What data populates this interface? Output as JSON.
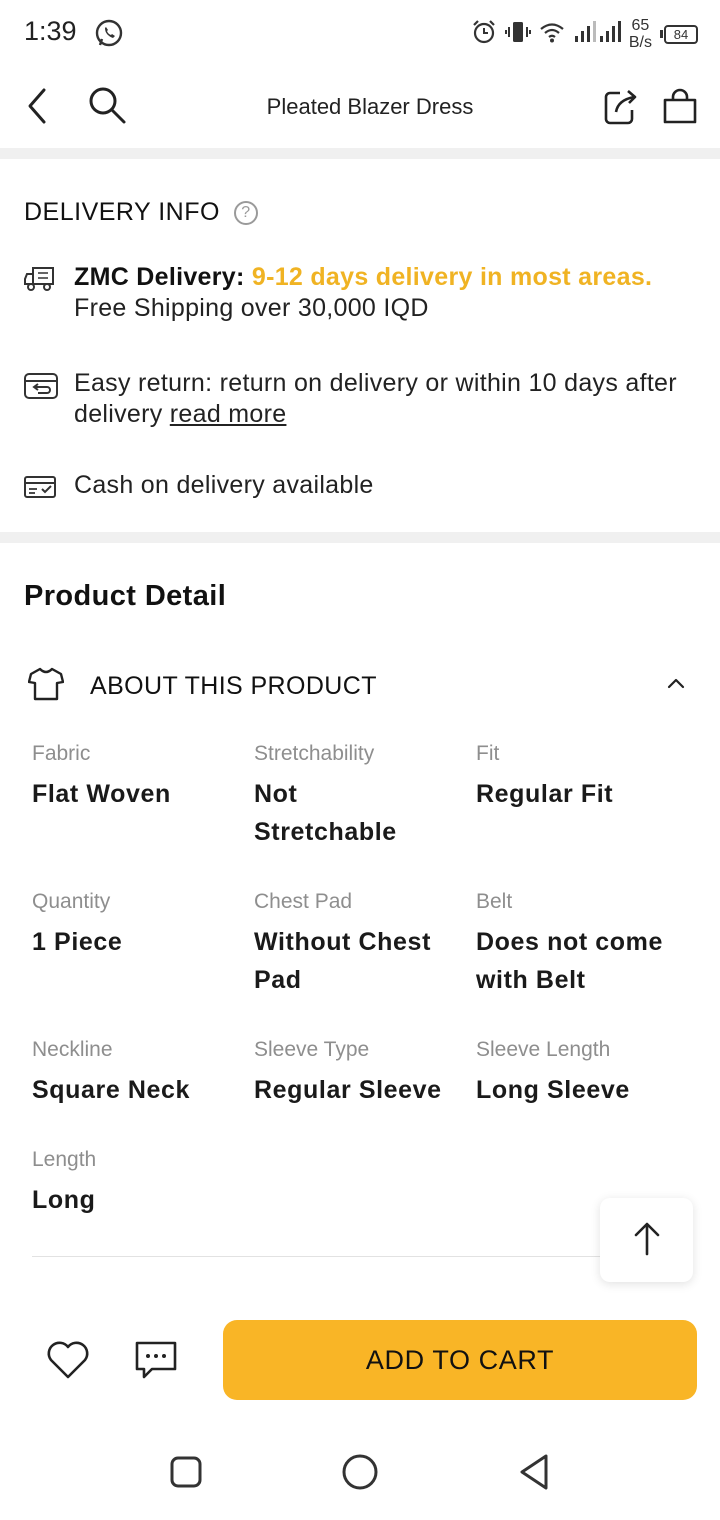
{
  "status_bar": {
    "time": "1:39",
    "net_speed_value": "65",
    "net_speed_unit": "B/s",
    "battery": "84"
  },
  "header": {
    "title": "Pleated Blazer Dress"
  },
  "delivery": {
    "title": "DELIVERY INFO",
    "help_glyph": "?",
    "zmc_label": "ZMC Delivery:",
    "zmc_highlight": "9-12 days delivery in most areas.",
    "zmc_rest": "Free Shipping over 30,000 IQD",
    "return_text": "Easy return: return on delivery or within 10 days after delivery",
    "return_link": "read more",
    "cod_text": "Cash on delivery available"
  },
  "product_detail": {
    "title": "Product Detail",
    "about_label": "ABOUT THIS PRODUCT",
    "attributes": [
      {
        "label": "Fabric",
        "value": "Flat Woven"
      },
      {
        "label": "Stretchability",
        "value": "Not Stretchable"
      },
      {
        "label": "Fit",
        "value": "Regular Fit"
      },
      {
        "label": "Quantity",
        "value": "1 Piece"
      },
      {
        "label": "Chest Pad",
        "value": "Without Chest Pad"
      },
      {
        "label": "Belt",
        "value": "Does not come with Belt"
      },
      {
        "label": "Neckline",
        "value": "Square Neck"
      },
      {
        "label": "Sleeve Type",
        "value": "Regular Sleeve"
      },
      {
        "label": "Sleeve Length",
        "value": "Long Sleeve"
      },
      {
        "label": "Length",
        "value": "Long"
      }
    ]
  },
  "actions": {
    "add_to_cart": "ADD TO CART"
  },
  "colors": {
    "accent": "#f0b323",
    "cart_button": "#f9b526"
  },
  "icons": [
    "whatsapp-icon",
    "alarm-icon",
    "vibrate-icon",
    "wifi-icon",
    "signal-icon",
    "battery-icon",
    "back-icon",
    "search-icon",
    "share-icon",
    "bag-icon",
    "help-icon",
    "truck-icon",
    "return-icon",
    "cash-icon",
    "shirt-icon",
    "chevron-up-icon",
    "arrow-up-icon",
    "heart-icon",
    "chat-icon",
    "nav-recents-icon",
    "nav-home-icon",
    "nav-back-icon"
  ]
}
